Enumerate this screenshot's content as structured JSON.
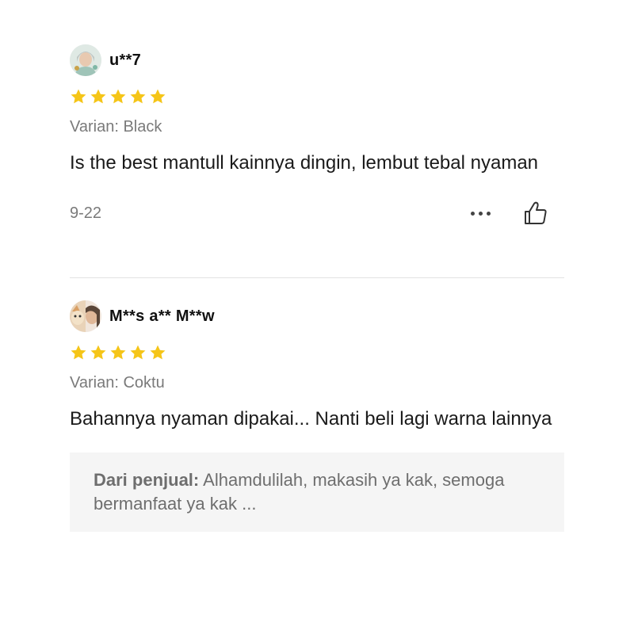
{
  "reviews": [
    {
      "username": "u**7",
      "rating": 5,
      "variant": "Varian: Black",
      "text": "Is the best mantull kainnya dingin, lembut tebal nyaman",
      "date": "9-22"
    },
    {
      "username": "M**s a** M**w",
      "rating": 5,
      "variant": "Varian: Coktu",
      "text": "Bahannya nyaman dipakai... Nanti beli lagi warna lainnya",
      "seller_reply": {
        "label": "Dari penjual:",
        "text": "Alhamdulilah, makasih ya kak, semoga bermanfaat ya kak ..."
      }
    }
  ],
  "colors": {
    "star": "#f5c518",
    "muted_text": "#7a7a7a",
    "reply_bg": "#f5f5f5",
    "divider": "#e3e3e3"
  },
  "icons": {
    "star": "star-icon",
    "more": "more-options-icon",
    "like": "thumbs-up-icon"
  }
}
